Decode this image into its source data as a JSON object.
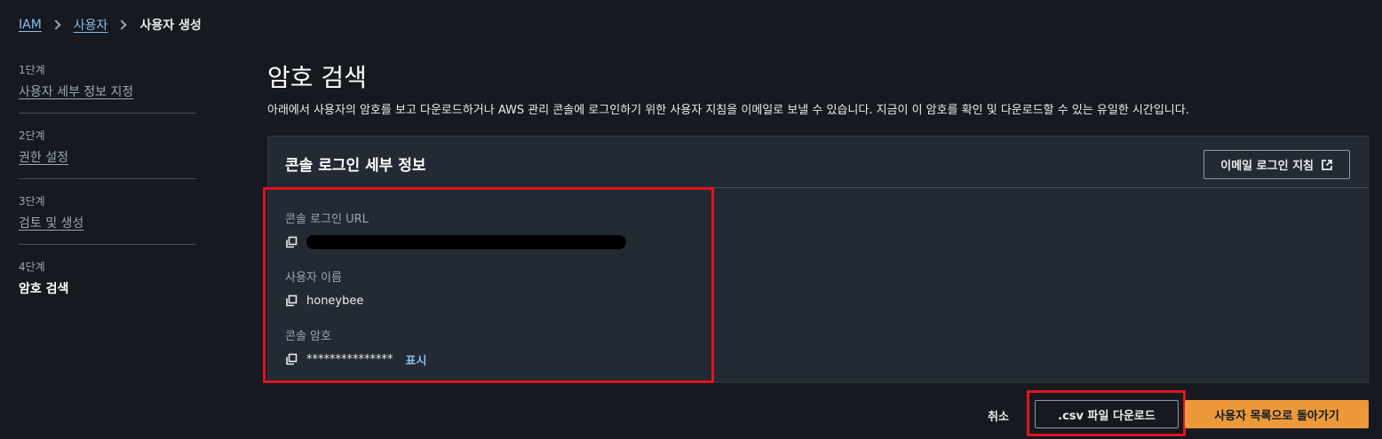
{
  "breadcrumb": {
    "items": [
      "IAM",
      "사용자"
    ],
    "current": "사용자 생성"
  },
  "steps": [
    {
      "num": "1단계",
      "label": "사용자 세부 정보 지정"
    },
    {
      "num": "2단계",
      "label": "권한 설정"
    },
    {
      "num": "3단계",
      "label": "검토 및 생성"
    },
    {
      "num": "4단계",
      "label": "암호 검색"
    }
  ],
  "page": {
    "title": "암호 검색",
    "description": "아래에서 사용자의 암호를 보고 다운로드하거나 AWS 관리 콘솔에 로그인하기 위한 사용자 지침을 이메일로 보낼 수 있습니다. 지금이 이 암호를 확인 및 다운로드할 수 있는 유일한 시간입니다."
  },
  "panel": {
    "title": "콘솔 로그인 세부 정보",
    "email_button": "이메일 로그인 지침",
    "fields": {
      "url": {
        "label": "콘솔 로그인 URL"
      },
      "username": {
        "label": "사용자 이름",
        "value": "honeybee"
      },
      "password": {
        "label": "콘솔 암호",
        "value": "***************",
        "show": "표시"
      }
    }
  },
  "actions": {
    "cancel": "취소",
    "csv": ".csv 파일 다운로드",
    "back": "사용자 목록으로 돌아가기"
  },
  "colors": {
    "background": "#16191f",
    "panel": "#232a33",
    "link": "#89bdee",
    "primary_button": "#ec9939",
    "highlight": "#e0141e"
  }
}
